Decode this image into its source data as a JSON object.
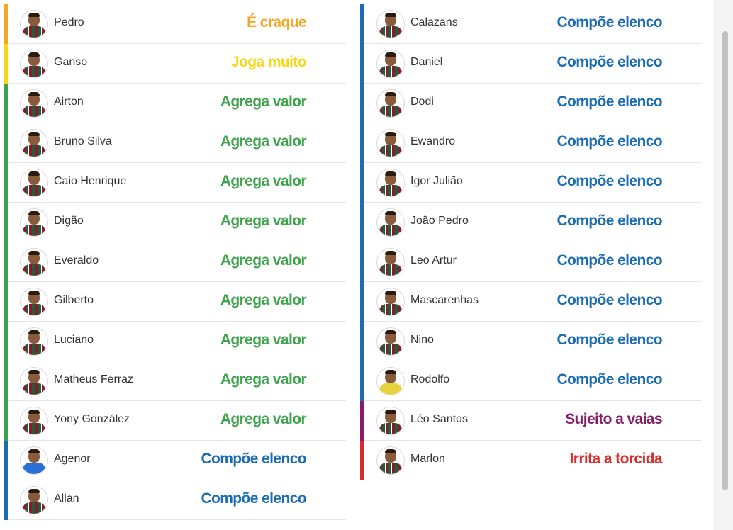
{
  "colors": {
    "orange": "#f5a623",
    "yellow": "#f5d916",
    "green": "#3fa34d",
    "blue": "#1a6cb5",
    "purple": "#8a1a6a",
    "red": "#d92d2d"
  },
  "left_column": [
    {
      "name": "Pedro",
      "status": "É craque",
      "color": "#f5a623",
      "bar": "#f5a623",
      "kit": "home"
    },
    {
      "name": "Ganso",
      "status": "Joga muito",
      "color": "#f5d916",
      "bar": "#f5d916",
      "kit": "home"
    },
    {
      "name": "Airton",
      "status": "Agrega valor",
      "color": "#3fa34d",
      "bar": "#3fa34d",
      "kit": "home"
    },
    {
      "name": "Bruno Silva",
      "status": "Agrega valor",
      "color": "#3fa34d",
      "bar": "#3fa34d",
      "kit": "home"
    },
    {
      "name": "Caio Henrique",
      "status": "Agrega valor",
      "color": "#3fa34d",
      "bar": "#3fa34d",
      "kit": "home"
    },
    {
      "name": "Digão",
      "status": "Agrega valor",
      "color": "#3fa34d",
      "bar": "#3fa34d",
      "kit": "home"
    },
    {
      "name": "Everaldo",
      "status": "Agrega valor",
      "color": "#3fa34d",
      "bar": "#3fa34d",
      "kit": "home"
    },
    {
      "name": "Gilberto",
      "status": "Agrega valor",
      "color": "#3fa34d",
      "bar": "#3fa34d",
      "kit": "home"
    },
    {
      "name": "Luciano",
      "status": "Agrega valor",
      "color": "#3fa34d",
      "bar": "#3fa34d",
      "kit": "home"
    },
    {
      "name": "Matheus Ferraz",
      "status": "Agrega valor",
      "color": "#3fa34d",
      "bar": "#3fa34d",
      "kit": "home"
    },
    {
      "name": "Yony González",
      "status": "Agrega valor",
      "color": "#3fa34d",
      "bar": "#3fa34d",
      "kit": "home"
    },
    {
      "name": "Agenor",
      "status": "Compõe elenco",
      "color": "#1a6cb5",
      "bar": "#1a6cb5",
      "kit": "blue"
    },
    {
      "name": "Allan",
      "status": "Compõe elenco",
      "color": "#1a6cb5",
      "bar": "#1a6cb5",
      "kit": "home"
    }
  ],
  "right_column": [
    {
      "name": "Calazans",
      "status": "Compõe elenco",
      "color": "#1a6cb5",
      "bar": "#1a6cb5",
      "kit": "home"
    },
    {
      "name": "Daniel",
      "status": "Compõe elenco",
      "color": "#1a6cb5",
      "bar": "#1a6cb5",
      "kit": "home"
    },
    {
      "name": "Dodi",
      "status": "Compõe elenco",
      "color": "#1a6cb5",
      "bar": "#1a6cb5",
      "kit": "home"
    },
    {
      "name": "Ewandro",
      "status": "Compõe elenco",
      "color": "#1a6cb5",
      "bar": "#1a6cb5",
      "kit": "home"
    },
    {
      "name": "Igor Julião",
      "status": "Compõe elenco",
      "color": "#1a6cb5",
      "bar": "#1a6cb5",
      "kit": "home"
    },
    {
      "name": "João Pedro",
      "status": "Compõe elenco",
      "color": "#1a6cb5",
      "bar": "#1a6cb5",
      "kit": "home"
    },
    {
      "name": "Leo Artur",
      "status": "Compõe elenco",
      "color": "#1a6cb5",
      "bar": "#1a6cb5",
      "kit": "home"
    },
    {
      "name": "Mascarenhas",
      "status": "Compõe elenco",
      "color": "#1a6cb5",
      "bar": "#1a6cb5",
      "kit": "home"
    },
    {
      "name": "Nino",
      "status": "Compõe elenco",
      "color": "#1a6cb5",
      "bar": "#1a6cb5",
      "kit": "home"
    },
    {
      "name": "Rodolfo",
      "status": "Compõe elenco",
      "color": "#1a6cb5",
      "bar": "#1a6cb5",
      "kit": "yellow"
    },
    {
      "name": "Léo Santos",
      "status": "Sujeito a vaias",
      "color": "#8a1a6a",
      "bar": "#8a1a6a",
      "kit": "home"
    },
    {
      "name": "Marlon",
      "status": "Irrita a torcida",
      "color": "#d92d2d",
      "bar": "#d92d2d",
      "kit": "home"
    }
  ]
}
